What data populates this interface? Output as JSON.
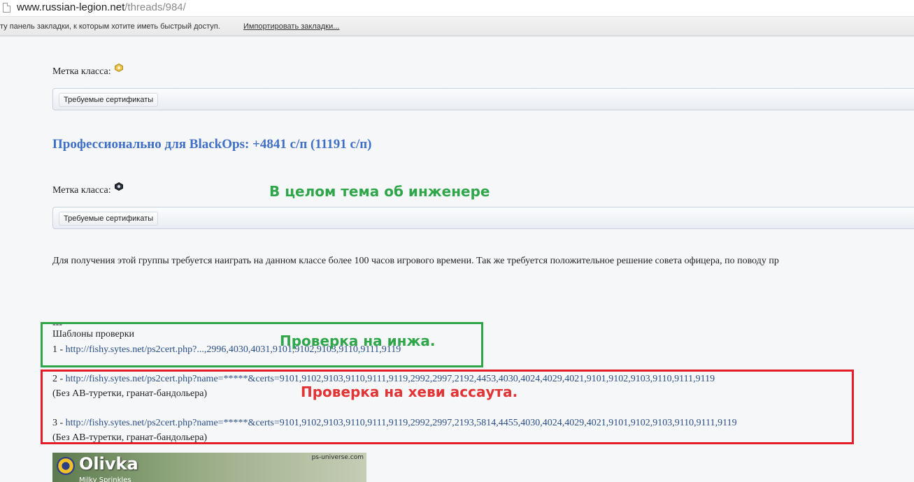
{
  "browser": {
    "url_host": "www.russian-legion.net",
    "url_path": "/threads/984/",
    "bookmarks_hint": "ту панель закладки, к которым хотите иметь быстрый доступ.",
    "import_link": "Импортировать закладки..."
  },
  "post": {
    "class_label": "Метка класса:",
    "required_certs_button": "Требуемые сертификаты",
    "heading": "Профессионально для BlackOps: +4841 с/п (11191 с/п)",
    "description": "Для получения этой группы требуется наиграть на данном классе более 100 часов игрового времени. Так же требуется положительное решение совета офицера, по поводу пр",
    "separator": "---",
    "templates_title": "Шаблоны проверки",
    "templates": [
      {
        "prefix": "1 - ",
        "url": "http://fishy.sytes.net/ps2cert.php?...,2996,4030,4031,9101,9102,9103,9110,9111,9119",
        "note": ""
      },
      {
        "prefix": "2 - ",
        "url": "http://fishy.sytes.net/ps2cert.php?name=*****&certs=9101,9102,9103,9110,9111,9119,2992,2997,2192,4453,4030,4024,4029,4021,9101,9102,9103,9110,9111,9119",
        "note": "(Без АВ-туретки, гранат-бандольера)"
      },
      {
        "prefix": "3 - ",
        "url": "http://fishy.sytes.net/ps2cert.php?name=*****&certs=9101,9102,9103,9110,9111,9119,2992,2997,2193,5814,4455,4030,4024,4029,4021,9101,9102,9103,9110,9111,9119",
        "note": "(Без АВ-туретки, гранат-бандольера)"
      }
    ]
  },
  "annotations": {
    "engineer_topic": "В целом тема об инженере",
    "engineer_check": "Проверка на инжа.",
    "heavy_check": "Проверка на хеви ассаута."
  },
  "signature": {
    "name": "Olivka",
    "subtitle": "Milky Sprinkles",
    "site": "ps-universe.com"
  },
  "colors": {
    "heading": "#3f6fc7",
    "annotation_green": "#2fa64a",
    "annotation_red": "#e23434",
    "link": "#2a4f86"
  }
}
